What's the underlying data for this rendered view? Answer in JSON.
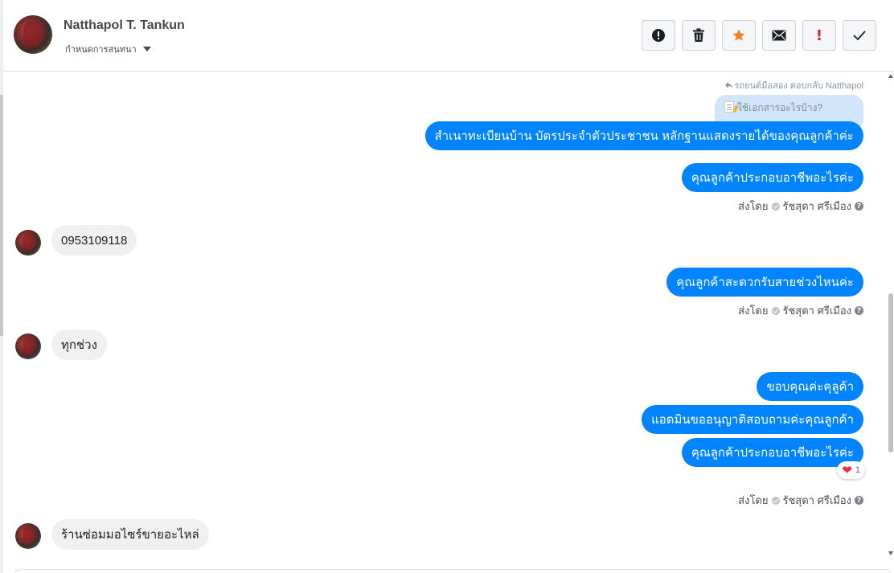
{
  "header": {
    "contact_name": "Natthapol T. Tankun",
    "label_dropdown": "กำหนดการสนทนา",
    "actions": [
      {
        "name": "report-button",
        "icon": "exclamation-circle-icon"
      },
      {
        "name": "delete-button",
        "icon": "trash-icon"
      },
      {
        "name": "star-button",
        "icon": "star-icon",
        "color": "#f48024"
      },
      {
        "name": "mark-unread-button",
        "icon": "envelope-icon"
      },
      {
        "name": "follow-up-button",
        "icon": "exclamation-icon",
        "color": "#e02020",
        "text": "!"
      },
      {
        "name": "done-button",
        "icon": "check-icon"
      }
    ]
  },
  "conversation": {
    "reply_note": "รถยนต์มือสอง ตอบกลับ Natthapol",
    "quoted_message": "ใช้เอกสารอะไรบ้าง?",
    "messages": {
      "m1": "สำเนาทะเบียนบ้าน บัตรประจำตัวประชาชน หลักฐานแสดงรายได้ของคุณลูกค้าค่ะ",
      "m2": "คุณลูกค้าประกอบอาชีพอะไรค่ะ",
      "m3": "0953109118",
      "m4": "คุณลูกค้าสะดวกรับสายช่วงไหนค่ะ",
      "m5": "ทุกช่วง",
      "m6": "ขอบคุณค่ะคุลูค้า",
      "m7": "แอดมินขออนุญาติสอบถามค่ะคุณลูกค้า",
      "m8": "คุณลูกค้าประกอบอาชีพอะไรค่ะ",
      "m9": "ร้านซ่อมมอไซร์ขายอะไหล่"
    },
    "sent_by_label": "ส่งโดย",
    "sender_name": "รัชสุดา ศรีเมือง",
    "help_glyph": "?",
    "reaction": {
      "emoji": "❤",
      "count": "1"
    }
  },
  "colors": {
    "outgoing_bubble": "#0084ff",
    "incoming_bubble": "#f1f0f0",
    "quoted_bubble": "#d3e5fb"
  }
}
